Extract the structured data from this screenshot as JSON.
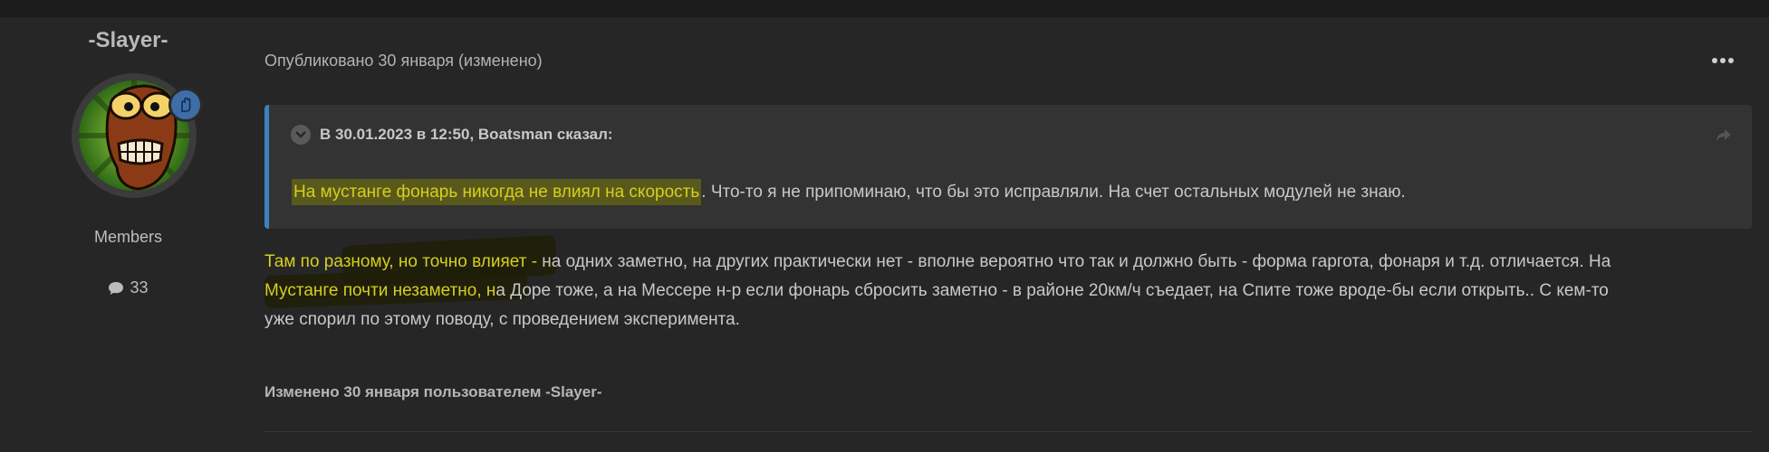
{
  "author": {
    "name": "-Slayer-",
    "group": "Members",
    "post_count": "33",
    "icons": {
      "badge": "hand-icon",
      "comment": "comment-bubble-icon"
    }
  },
  "post": {
    "meta": "Опубликовано 30 января (изменено)",
    "menu_icon": "ellipsis-icon",
    "quote": {
      "header": "В 30.01.2023 в 12:50, Boatsman сказал:",
      "highlight": "На мустанге фонарь никогда не влиял на скорость",
      "rest": ". Что-то я не припоминаю, что бы это исправляли. На счет остальных модулей не знаю.",
      "icons": {
        "toggle": "chevron-down-icon",
        "share": "share-icon"
      }
    },
    "body": {
      "line1_highlight": "Там по разному, но точно влияет -",
      "line1_rest": " на одних заметно, на других практически нет - вполне вероятно что так и должно быть - форма гаргота, фонаря и т.д. отличается. На",
      "line2_highlight": "Мустанге почти незаметно, н",
      "line2_rest": "а Доре тоже, а на Мессере н-р если фонарь сбросить заметно - в районе 20км/ч съедает, на Спите тоже вроде-бы если открыть.. С кем-то",
      "line3": "уже спорил по этому поводу, с проведением эксперимента."
    },
    "edited": "Изменено 30 января пользователем -Slayer-"
  },
  "colors": {
    "background": "#262626",
    "quote_bg": "#333333",
    "quote_border": "#3e7fc1",
    "highlight_text": "#d6cf1c",
    "badge": "#3f6da6"
  }
}
